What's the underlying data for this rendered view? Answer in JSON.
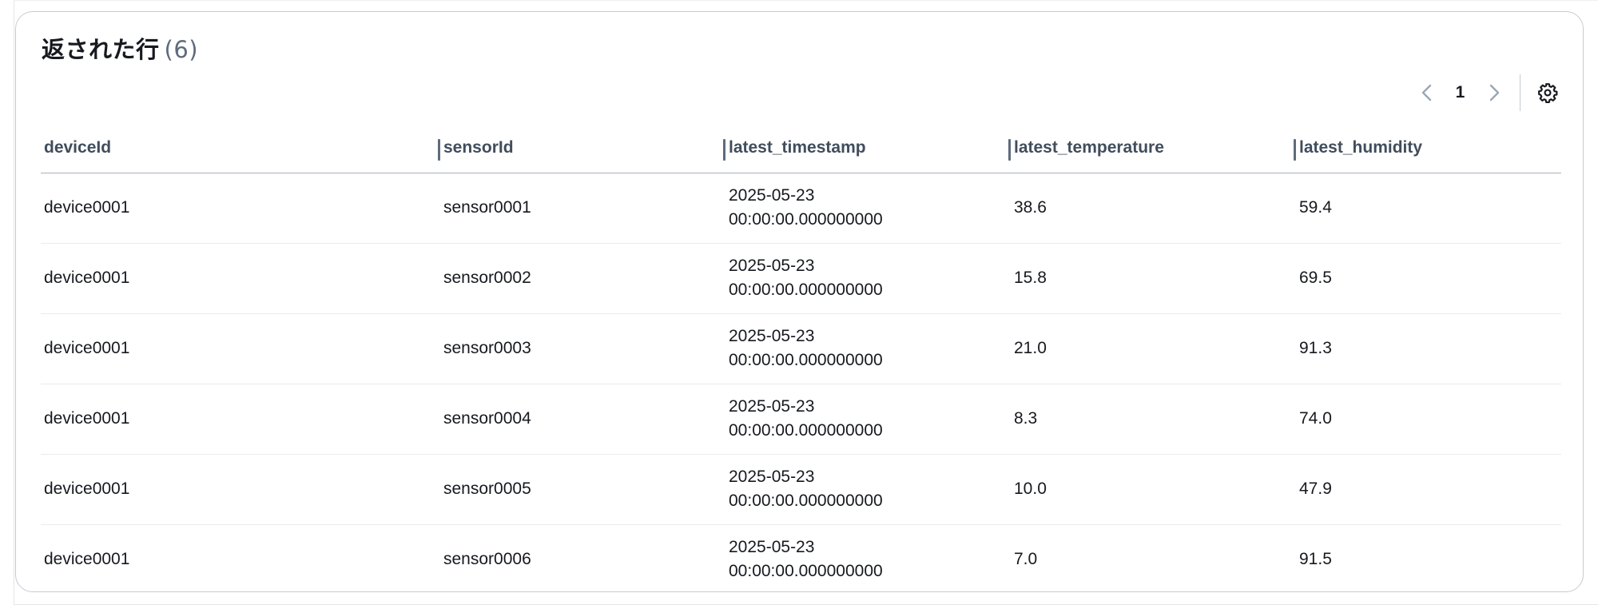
{
  "panel": {
    "title": "返された行",
    "count": "(6)"
  },
  "pagination": {
    "current_page": "1",
    "prev_icon": "chevron-left-icon",
    "next_icon": "chevron-right-icon",
    "settings_icon": "gear-icon"
  },
  "table": {
    "columns": [
      "deviceId",
      "sensorId",
      "latest_timestamp",
      "latest_temperature",
      "latest_humidity"
    ],
    "rows": [
      {
        "deviceId": "device0001",
        "sensorId": "sensor0001",
        "ts_date": "2025-05-23",
        "ts_time": "00:00:00.000000000",
        "temperature": "38.6",
        "humidity": "59.4"
      },
      {
        "deviceId": "device0001",
        "sensorId": "sensor0002",
        "ts_date": "2025-05-23",
        "ts_time": "00:00:00.000000000",
        "temperature": "15.8",
        "humidity": "69.5"
      },
      {
        "deviceId": "device0001",
        "sensorId": "sensor0003",
        "ts_date": "2025-05-23",
        "ts_time": "00:00:00.000000000",
        "temperature": "21.0",
        "humidity": "91.3"
      },
      {
        "deviceId": "device0001",
        "sensorId": "sensor0004",
        "ts_date": "2025-05-23",
        "ts_time": "00:00:00.000000000",
        "temperature": "8.3",
        "humidity": "74.0"
      },
      {
        "deviceId": "device0001",
        "sensorId": "sensor0005",
        "ts_date": "2025-05-23",
        "ts_time": "00:00:00.000000000",
        "temperature": "10.0",
        "humidity": "47.9"
      },
      {
        "deviceId": "device0001",
        "sensorId": "sensor0006",
        "ts_date": "2025-05-23",
        "ts_time": "00:00:00.000000000",
        "temperature": "7.0",
        "humidity": "91.5"
      }
    ]
  }
}
